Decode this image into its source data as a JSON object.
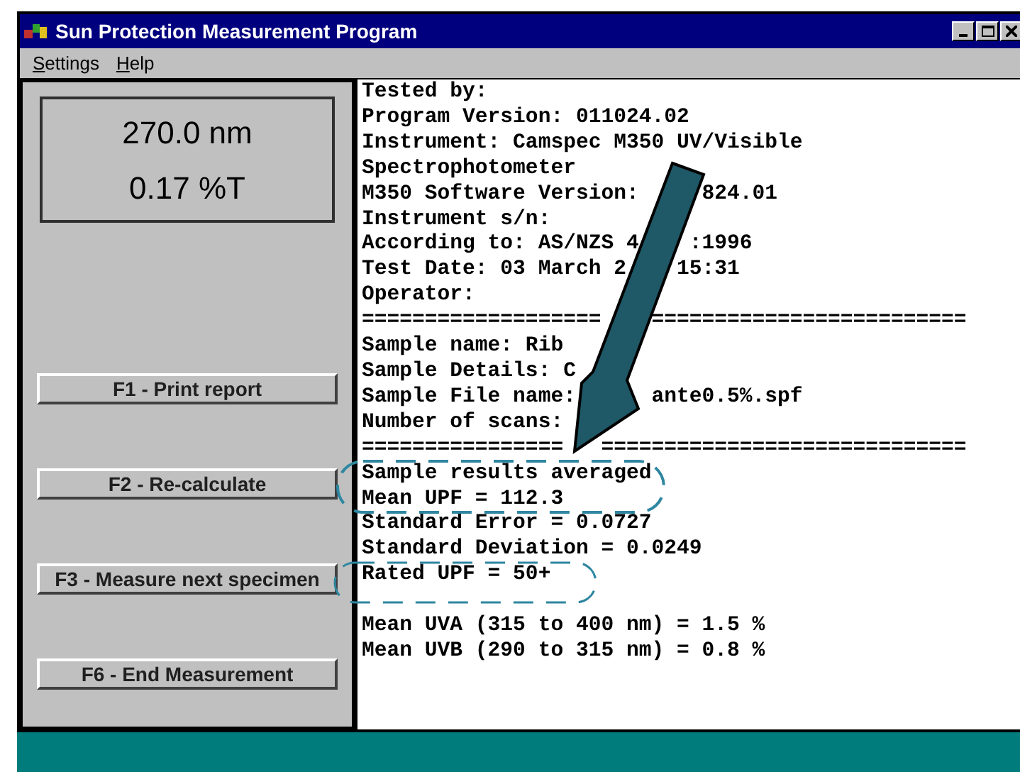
{
  "window": {
    "title": "Sun Protection Measurement Program"
  },
  "menu": [
    {
      "key": "S",
      "rest": "ettings"
    },
    {
      "key": "H",
      "rest": "elp"
    }
  ],
  "readout": {
    "wavelength": "270.0 nm",
    "transmittance": "0.17 %T"
  },
  "buttons": [
    "F1 - Print report",
    "F2 - Re-calculate",
    "F3 - Measure next specimen",
    "F6 - End Measurement"
  ],
  "report": {
    "lines": [
      "Tested by:",
      "Program Version: 011024.02",
      "Instrument: Camspec M350 UV/Visible",
      "Spectrophotometer",
      "M350 Software Version:     824.01",
      "Instrument s/n:",
      "According to: AS/NZS 4    :1996",
      "Test Date: 03 March 2    15:31",
      "Operator:",
      "===================    =========================",
      "Sample name: Rib",
      "Sample Details: C",
      "Sample File name:      ante0.5%.spf",
      "Number of scans:",
      "================   =============================",
      "Sample results averaged",
      "Mean UPF = 112.3",
      "Standard Error = 0.0727",
      "Standard Deviation = 0.0249",
      "Rated UPF = 50+"
    ],
    "summary_lines": [
      "Mean UVA (315 to 400 nm) = 1.5 %",
      "Mean UVB (290 to 315 nm) = 0.8 %"
    ]
  }
}
